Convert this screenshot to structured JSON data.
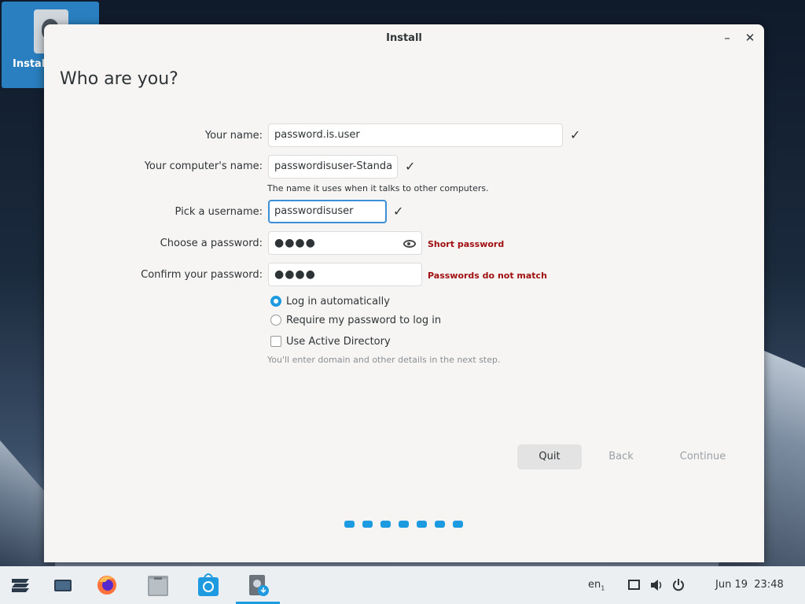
{
  "desktop": {
    "icon_label": "Install"
  },
  "window": {
    "title": "Install",
    "minimize_glyph": "–",
    "close_glyph": "✕"
  },
  "page": {
    "heading": "Who are you?"
  },
  "form": {
    "name_label": "Your name:",
    "name_value": "password.is.user",
    "computer_label": "Your computer's name:",
    "computer_value": "passwordisuser-Standa",
    "computer_hint": "The name it uses when it talks to other computers.",
    "username_label": "Pick a username:",
    "username_value": "passwordisuser",
    "password_label": "Choose a password:",
    "password_value": "●●●●",
    "password_error": "Short password",
    "confirm_label": "Confirm your password:",
    "confirm_value": "●●●●",
    "confirm_error": "Passwords do not match",
    "check_glyph": "✓",
    "login_auto_label": "Log in automatically",
    "login_auto_selected": true,
    "require_password_label": "Require my password to log in",
    "active_directory_label": "Use Active Directory",
    "active_directory_checked": false,
    "active_directory_hint": "You'll enter domain and other details in the next step."
  },
  "buttons": {
    "quit": "Quit",
    "back": "Back",
    "continue": "Continue"
  },
  "steps": {
    "count": 7
  },
  "taskbar": {
    "keyboard_layout": "en",
    "keyboard_sub": "1",
    "date": "Jun 19",
    "time": "23:48"
  },
  "colors": {
    "accent": "#1e9be0",
    "error": "#a01010"
  }
}
